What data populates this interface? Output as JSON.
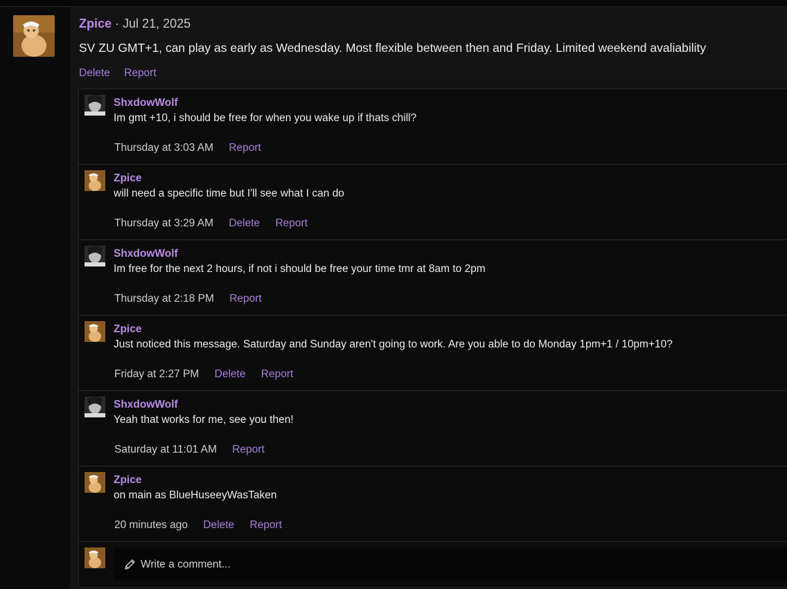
{
  "post": {
    "author": "Zpice",
    "separator": "·",
    "date": "Jul 21, 2025",
    "body": "SV ZU GMT+1, can play as early as Wednesday. Most flexible between then and Friday. Limited weekend avaliability",
    "actions": {
      "delete": "Delete",
      "report": "Report"
    }
  },
  "comments": [
    {
      "author": "ShxdowWolf",
      "avatar": "grey-portrait-avatar",
      "text": "Im gmt +10, i should be free for when you wake up if thats chill?",
      "time": "Thursday at 3:03 AM",
      "delete": "",
      "report": "Report"
    },
    {
      "author": "Zpice",
      "avatar": "cat-avatar",
      "text": "will need a specific time but I'll see what I can do",
      "time": "Thursday at 3:29 AM",
      "delete": "Delete",
      "report": "Report"
    },
    {
      "author": "ShxdowWolf",
      "avatar": "grey-portrait-avatar",
      "text": "Im free for the next 2 hours, if not i should be free your time tmr at 8am to 2pm",
      "time": "Thursday at 2:18 PM",
      "delete": "",
      "report": "Report"
    },
    {
      "author": "Zpice",
      "avatar": "cat-avatar",
      "text": "Just noticed this message. Saturday and Sunday aren't going to work. Are you able to do Monday 1pm+1 / 10pm+10?",
      "time": "Friday at 2:27 PM",
      "delete": "Delete",
      "report": "Report"
    },
    {
      "author": "ShxdowWolf",
      "avatar": "grey-portrait-avatar",
      "text": "Yeah that works for me, see you then!",
      "time": "Saturday at 11:01 AM",
      "delete": "",
      "report": "Report"
    },
    {
      "author": "Zpice",
      "avatar": "cat-avatar",
      "text": "on main as BlueHuseeyWasTaken",
      "time": "20 minutes ago",
      "delete": "Delete",
      "report": "Report"
    }
  ],
  "reply": {
    "placeholder": "Write a comment...",
    "icon": "pencil-icon"
  },
  "colors": {
    "accent": "#b98be6",
    "link": "#a57fdb",
    "background": "#0c0c0c"
  }
}
